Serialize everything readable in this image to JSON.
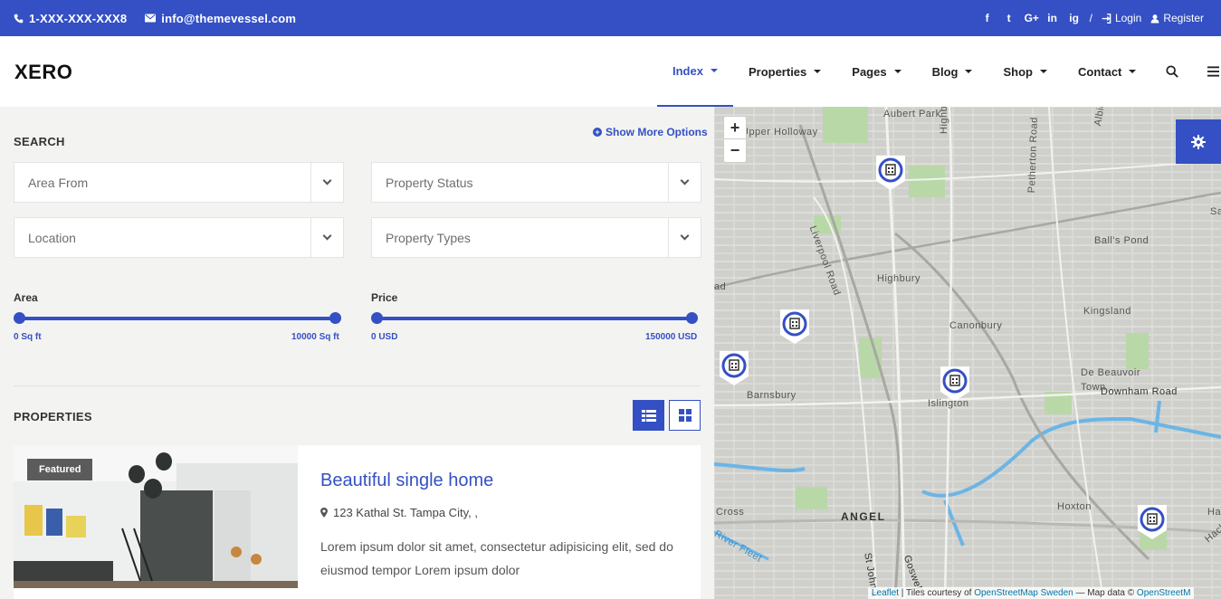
{
  "topbar": {
    "phone": "1-XXX-XXX-XXX8",
    "email": "info@themevessel.com",
    "social": [
      "f",
      "t",
      "G+",
      "in",
      "ig"
    ],
    "separator": "/",
    "login": "Login",
    "register": "Register"
  },
  "header": {
    "logo": "XERO",
    "nav": [
      {
        "label": "Index",
        "active": true
      },
      {
        "label": "Properties"
      },
      {
        "label": "Pages"
      },
      {
        "label": "Blog"
      },
      {
        "label": "Shop"
      },
      {
        "label": "Contact"
      }
    ]
  },
  "search": {
    "title": "SEARCH",
    "more_options": "Show More Options",
    "selects": [
      "Area From",
      "Property Status",
      "Location",
      "Property Types"
    ],
    "area": {
      "label": "Area",
      "min": "0 Sq ft",
      "max": "10000 Sq ft"
    },
    "price": {
      "label": "Price",
      "min": "0 USD",
      "max": "150000 USD"
    }
  },
  "properties": {
    "title": "PROPERTIES",
    "card": {
      "badge": "Featured",
      "title": "Beautiful single home",
      "address": "123 Kathal St. Tampa City, ,",
      "description": "Lorem ipsum dolor sit amet, consectetur adipisicing elit, sed do eiusmod tempor Lorem ipsum dolor"
    }
  },
  "map": {
    "zoom_in": "+",
    "zoom_out": "−",
    "labels": [
      "Aubert Park",
      "Highbury",
      "Petherton Road",
      "Upper Holloway",
      "Liverpool Road",
      "Ball's Pond",
      "Highbury",
      "Canonbury",
      "Kingsland",
      "Barnsbury",
      "Islington",
      "De Beauvoir Town",
      "Downham Road",
      "ANGEL",
      "Hoxton",
      "River Fleet",
      "St John's",
      "Goswell",
      "Cross",
      "Albion",
      "Sa",
      "Ha",
      "Hack",
      "ad"
    ],
    "attribution": {
      "leaflet": "Leaflet",
      "tiles": " | Tiles courtesy of ",
      "tiles_link": "OpenStreetMap Sweden",
      "data": " — Map data © ",
      "data_link": "OpenStreetM"
    }
  },
  "colors": {
    "accent": "#3450c4"
  }
}
